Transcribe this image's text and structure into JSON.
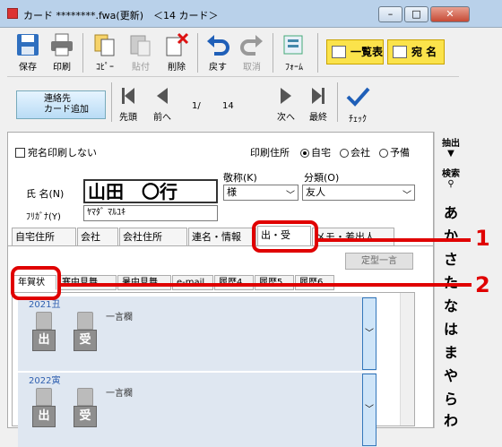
{
  "window": {
    "title": "カード ********.fwa(更新)　＜14 カード＞",
    "minimize": "–",
    "maximize": "□",
    "close": "✕"
  },
  "toolbar": {
    "save": "保存",
    "print": "印刷",
    "copy": "ｺﾋﾟｰ",
    "paste": "貼付",
    "delete": "削除",
    "undo": "戻す",
    "redo": "取消",
    "form": "ﾌｫｰﾑ",
    "list": "一覧表",
    "address": "宛 名"
  },
  "nav": {
    "add_card": "連絡先\nカード追加",
    "first": "先頭",
    "prev": "前へ",
    "position": "1/",
    "total": "14",
    "next": "次へ",
    "last": "最終",
    "check": "ﾁｪｯｸ"
  },
  "form": {
    "no_print_label": "宛名印刷しない",
    "print_address_label": "印刷住所",
    "radios": [
      "自宅",
      "会社",
      "予備"
    ],
    "title_label": "敬称(K)",
    "title_value": "様",
    "category_label": "分類(O)",
    "category_value": "友人",
    "name_label": "氏 名(N)",
    "name_value": "山田　〇行",
    "furigana_label": "ﾌﾘｶﾞﾅ(Y)",
    "furigana_value": "ﾔﾏﾀﾞ ﾏﾙﾕｷ"
  },
  "tabs": [
    "自宅住所",
    "会社",
    "会社住所",
    "連名・情報",
    "出・受",
    "メモ・差出人"
  ],
  "template_button": "定型一言",
  "subtabs": [
    "年賀状",
    "寒中見舞",
    "暑中見舞",
    "e-mail",
    "履歴4",
    "履歴5",
    "履歴6"
  ],
  "records": [
    {
      "year": "2021丑",
      "sent": "出",
      "received": "受",
      "memo": "一言欄"
    },
    {
      "year": "2022寅",
      "sent": "出",
      "received": "受",
      "memo": "一言欄"
    }
  ],
  "rightbar": {
    "extract": "抽出",
    "search": "検索",
    "kana": [
      "あ",
      "か",
      "さ",
      "た",
      "な",
      "は",
      "ま",
      "や",
      "ら",
      "わ"
    ]
  },
  "callouts": [
    "1",
    "2"
  ],
  "colors": {
    "callout": "#e00000",
    "accent_yellow": "#fbe34b",
    "title_bar": "#b9d1ea"
  },
  "icons": [
    "save-icon",
    "print-icon",
    "copy-icon",
    "paste-icon",
    "delete-icon",
    "undo-icon",
    "redo-icon",
    "form-icon",
    "first-icon",
    "prev-icon",
    "next-icon",
    "last-icon",
    "check-icon",
    "filter-icon",
    "search-icon"
  ]
}
